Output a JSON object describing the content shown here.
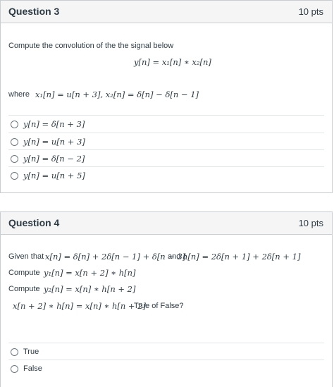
{
  "q3": {
    "title": "Question 3",
    "points": "10 pts",
    "prompt": "Compute the convolution of the the signal below",
    "equation": "y[n] = x₁[n] ∗ x₂[n]",
    "where_label": "where",
    "where_math": "x₁[n] = u[n + 3], x₂[n] = δ[n] − δ[n − 1]",
    "answers": [
      "y[n] = δ[n + 3]",
      "y[n] = u[n + 3]",
      "y[n] = δ[n − 2]",
      "y[n] = u[n + 5]"
    ]
  },
  "q4": {
    "title": "Question 4",
    "points": "10 pts",
    "given_label": "Given that",
    "given_x": "x[n] = δ[n] + 2δ[n − 1] + δ[n − 3]",
    "and_label": "and",
    "given_h": "h[n] = 2δ[n + 1] + 2δ[n + 1]",
    "compute_label": "Compute",
    "y1": "y₁[n] = x[n + 2] ∗ h[n]",
    "y2": "y₂[n] = x[n] ∗ h[n + 2]",
    "statement": "x[n + 2] ∗ h[n] = x[n] ∗ h[n + 2]",
    "tf_label": "True of False?",
    "answers": [
      "True",
      "False"
    ]
  }
}
